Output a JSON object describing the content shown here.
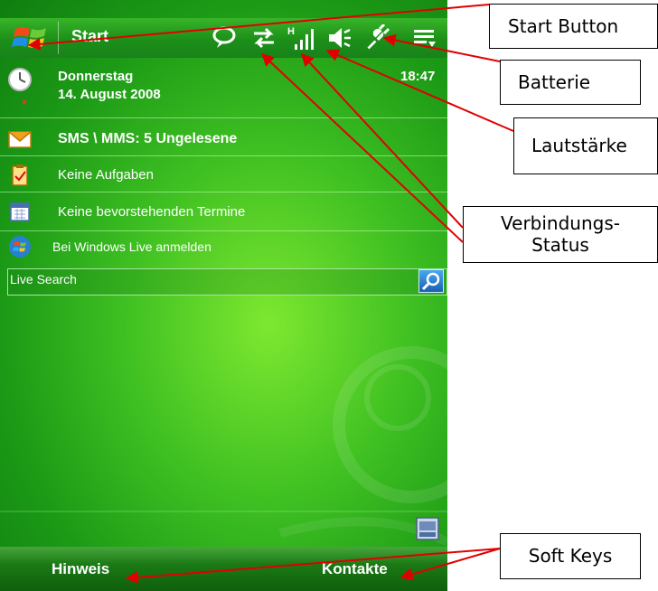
{
  "title_bar": {
    "title": "Start"
  },
  "today": {
    "weekday": "Donnerstag",
    "date": "14. August 2008",
    "time": "18:47",
    "messages": "SMS \\ MMS: 5 Ungelesene",
    "tasks": "Keine Aufgaben",
    "appointments": "Keine bevorstehenden Termine",
    "windows_live": "Bei Windows Live anmelden"
  },
  "search": {
    "label": "Live Search"
  },
  "softkeys": {
    "left": "Hinweis",
    "right": "Kontakte"
  },
  "callouts": {
    "start_button": "Start Button",
    "battery": "Batterie",
    "volume": "Lautstärke",
    "connection_line1": "Verbindungs-",
    "connection_line2": "Status",
    "soft_keys": "Soft Keys"
  },
  "colors": {
    "arrow": "#e00000",
    "accent_green": "#3fc022"
  },
  "icons": {
    "start": "windows-flag-icon",
    "notification": "speech-bubble-icon",
    "data_connection": "sync-arrows-icon",
    "signal": "signal-strength-icon",
    "volume": "speaker-icon",
    "battery": "plug-icon",
    "menu": "menu-icon",
    "clock": "clock-icon",
    "messages": "envelope-icon",
    "tasks": "clipboard-icon",
    "calendar": "calendar-icon",
    "live": "windows-live-icon",
    "search": "magnifier-icon",
    "keyboard": "keyboard-icon"
  }
}
